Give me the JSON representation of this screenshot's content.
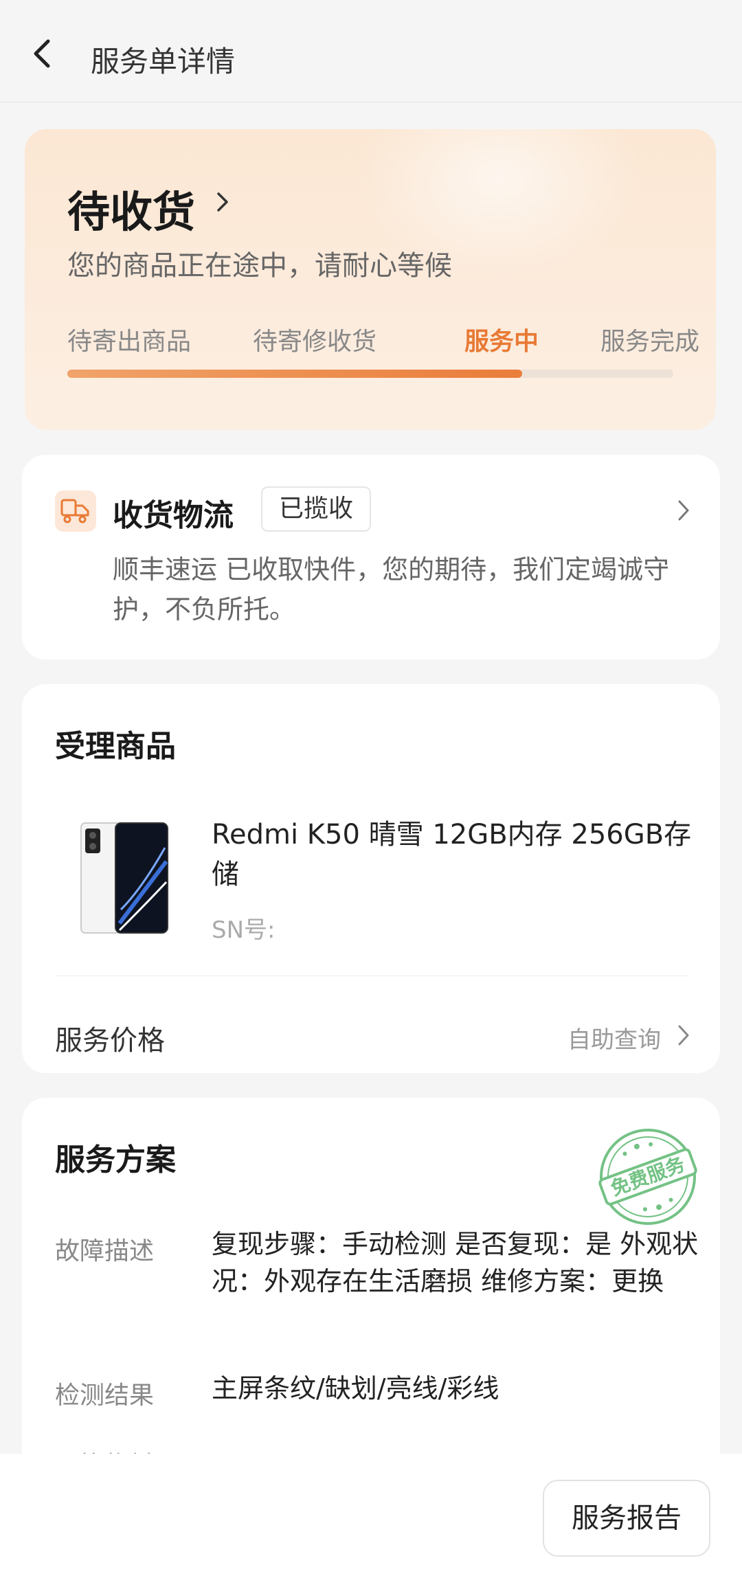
{
  "header": {
    "title": "服务单详情"
  },
  "status": {
    "title": "待收货",
    "subtitle": "您的商品正在途中，请耐心等候",
    "steps": [
      "待寄出商品",
      "待寄修收货",
      "服务中",
      "服务完成"
    ],
    "active_step": "服务中",
    "progress": 0.75,
    "accent_color": "#e87a35"
  },
  "logistics": {
    "title": "收货物流",
    "badge": "已揽收",
    "description": "顺丰速运 已收取快件，您的期待，我们定竭诚守护，不负所托。"
  },
  "product": {
    "section_title": "受理商品",
    "name": "Redmi K50 晴雪 12GB内存 256GB存储",
    "sn_label": "SN号:",
    "price_label": "服务价格",
    "price_link": "自助查询"
  },
  "plan": {
    "section_title": "服务方案",
    "stamp_text": "免费服务",
    "rows": [
      {
        "label": "故障描述",
        "value": "复现步骤：手动检测 是否复现：是 外观状况：外观存在生活磨损 维修方案：更换"
      },
      {
        "label": "检测结果",
        "value": "主屏条纹/缺划/亮线/彩线"
      },
      {
        "label": "更换物料",
        "value": ""
      }
    ]
  },
  "footer": {
    "report_button": "服务报告"
  },
  "icons": {
    "back": "back-arrow-icon",
    "chevron": "chevron-right-icon",
    "logistics": "delivery-truck-icon",
    "phone_image": "phone-product-image",
    "stamp": "free-service-stamp"
  }
}
